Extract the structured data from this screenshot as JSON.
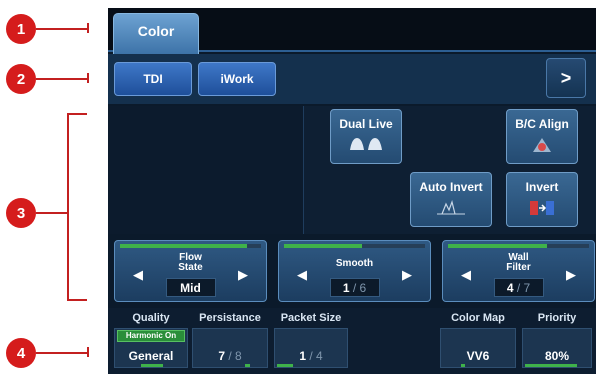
{
  "callouts": [
    "1",
    "2",
    "3",
    "4"
  ],
  "tabs": [
    {
      "label": "Color"
    }
  ],
  "mode_buttons": {
    "tdi": "TDI",
    "iwork": "iWork",
    "next": ">"
  },
  "functions": {
    "dual_live": "Dual Live",
    "bc_align": "B/C Align",
    "auto_invert": "Auto Invert",
    "invert": "Invert"
  },
  "knobs": [
    {
      "label": "Flow\nState",
      "value": "Mid",
      "total": "",
      "level": 0.9
    },
    {
      "label": "Smooth",
      "value": "1",
      "total": "/ 6",
      "level": 0.55
    },
    {
      "label": "Wall\nFilter",
      "value": "4",
      "total": "/ 7",
      "level": 0.7
    }
  ],
  "params": [
    {
      "title": "Quality",
      "badge": "Harmonic On",
      "value": "General",
      "total": ""
    },
    {
      "title": "Persistance",
      "value": "7",
      "total": "/ 8"
    },
    {
      "title": "Packet Size",
      "value": "1",
      "total": "/ 4"
    },
    {
      "title": "Color Map",
      "value": "VV6",
      "total": ""
    },
    {
      "title": "Priority",
      "value": "80%",
      "total": ""
    }
  ],
  "colors": {
    "accent": "#3fb24a",
    "callout": "#d51c1c",
    "button_blue": "#2b5fa8"
  },
  "icons": [
    "dual-live-icon",
    "bc-align-icon",
    "auto-invert-icon",
    "invert-icon",
    "arrow-left-icon",
    "arrow-right-icon",
    "chevron-right-icon"
  ]
}
